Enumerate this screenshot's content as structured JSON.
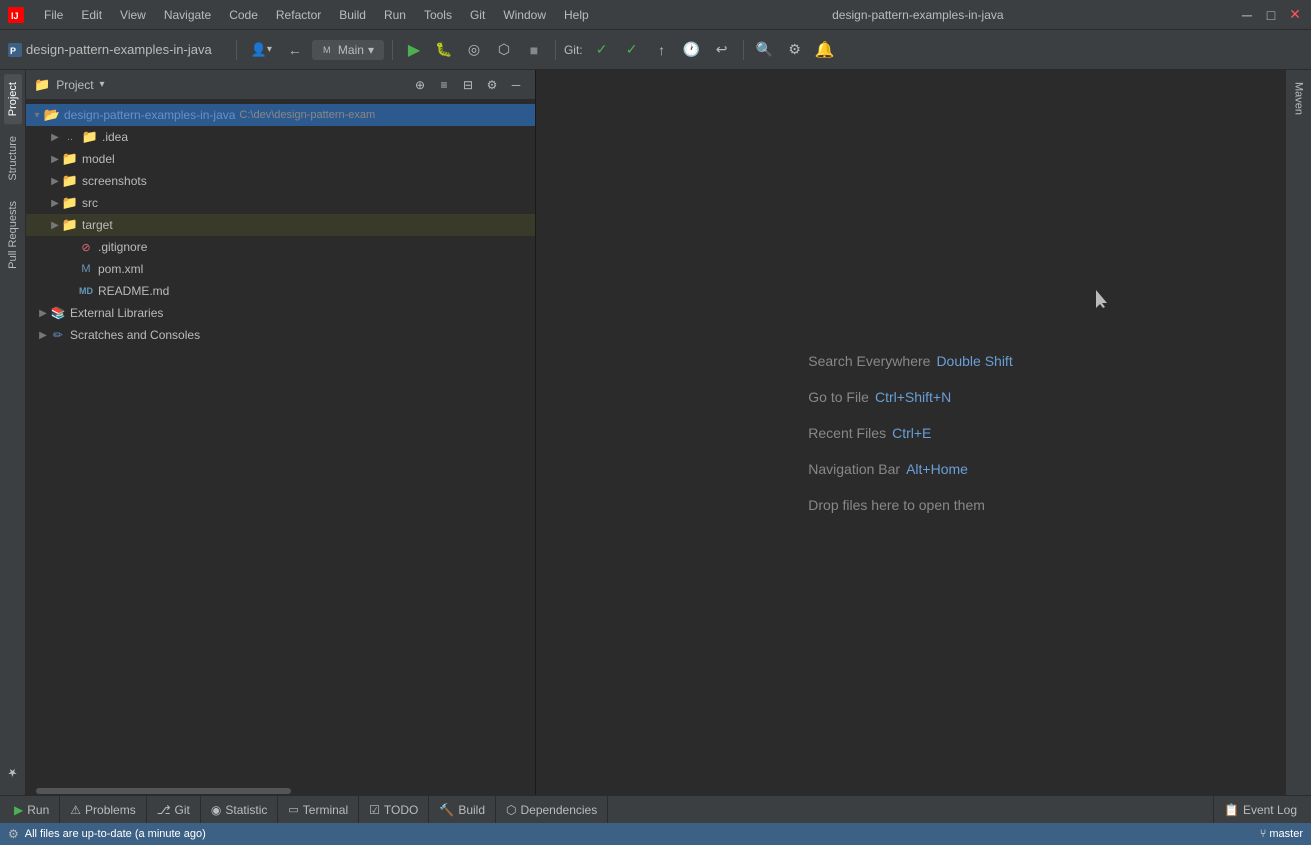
{
  "titlebar": {
    "logo": "IJ",
    "project": "design-pattern-examples-in-java",
    "menu": [
      "File",
      "Edit",
      "View",
      "Navigate",
      "Code",
      "Refactor",
      "Build",
      "Run",
      "Tools",
      "Git",
      "Window",
      "Help"
    ],
    "windowTitle": "design-pattern-examples-in-java",
    "minBtn": "─",
    "maxBtn": "□",
    "closeBtn": "✕"
  },
  "toolbar": {
    "projectName": "design-pattern-examples-in-java",
    "branchLabel": "Main",
    "gitLabel": "Git:",
    "icons": {
      "back": "←",
      "forward": "→",
      "globe": "🌐",
      "collapse": "≡",
      "settings": "⚙",
      "hide": "─",
      "run": "▶",
      "debug": "🐛",
      "coverage": "◎",
      "profile": "⬡",
      "stop": "■",
      "commit": "✓",
      "push": "↑",
      "update": "↓",
      "history": "🕐",
      "rollback": "↩",
      "search": "🔍",
      "settings2": "⚙"
    }
  },
  "sidebar": {
    "leftTabs": [
      "Project",
      "Structure",
      "Pull Requests",
      "Favorites"
    ]
  },
  "projectPanel": {
    "title": "Project",
    "dropdownArrow": "▾",
    "headerIcons": [
      "⊕",
      "≡",
      "⊟",
      "⚙",
      "─"
    ],
    "tree": [
      {
        "id": "root",
        "level": 0,
        "expanded": true,
        "selected": true,
        "icon": "folder-open",
        "label": "design-pattern-examples-in-java",
        "path": "C:\\dev\\design-pattern-exam",
        "type": "root"
      },
      {
        "id": "idea",
        "level": 1,
        "expanded": false,
        "icon": "folder",
        "label": ".idea",
        "type": "folder"
      },
      {
        "id": "model",
        "level": 1,
        "expanded": false,
        "icon": "folder",
        "label": "model",
        "type": "folder"
      },
      {
        "id": "screenshots",
        "level": 1,
        "expanded": false,
        "icon": "folder",
        "label": "screenshots",
        "type": "folder"
      },
      {
        "id": "src",
        "level": 1,
        "expanded": false,
        "icon": "folder",
        "label": "src",
        "type": "folder"
      },
      {
        "id": "target",
        "level": 1,
        "expanded": false,
        "selected": false,
        "highlighted": true,
        "icon": "folder-yellow",
        "label": "target",
        "type": "folder"
      },
      {
        "id": "gitignore",
        "level": 2,
        "icon": "git-file",
        "label": ".gitignore",
        "type": "file"
      },
      {
        "id": "pomxml",
        "level": 2,
        "icon": "xml-file",
        "label": "pom.xml",
        "type": "file"
      },
      {
        "id": "readme",
        "level": 2,
        "icon": "md-file",
        "label": "README.md",
        "type": "file"
      },
      {
        "id": "extlibs",
        "level": 1,
        "expanded": false,
        "icon": "ext-lib",
        "label": "External Libraries",
        "type": "special"
      },
      {
        "id": "scratches",
        "level": 1,
        "expanded": false,
        "icon": "scratch",
        "label": "Scratches and Consoles",
        "type": "special"
      }
    ]
  },
  "editor": {
    "hints": [
      {
        "text": "Search Everywhere",
        "shortcut": "Double Shift"
      },
      {
        "text": "Go to File",
        "shortcut": "Ctrl+Shift+N"
      },
      {
        "text": "Recent Files",
        "shortcut": "Ctrl+E"
      },
      {
        "text": "Navigation Bar",
        "shortcut": "Alt+Home"
      },
      {
        "text": "Drop files here to open them",
        "shortcut": ""
      }
    ]
  },
  "rightPanel": {
    "mavenLabel": "Maven"
  },
  "bottomTabs": [
    {
      "id": "run",
      "icon": "▶",
      "label": "Run"
    },
    {
      "id": "problems",
      "icon": "⚠",
      "label": "Problems"
    },
    {
      "id": "git",
      "icon": "⎇",
      "label": "Git"
    },
    {
      "id": "statistic",
      "icon": "◉",
      "label": "Statistic"
    },
    {
      "id": "terminal",
      "icon": ">_",
      "label": "Terminal"
    },
    {
      "id": "todo",
      "icon": "☑",
      "label": "TODO"
    },
    {
      "id": "build",
      "icon": "🔨",
      "label": "Build"
    },
    {
      "id": "dependencies",
      "icon": "⬡",
      "label": "Dependencies"
    }
  ],
  "statusBar": {
    "message": "All files are up-to-date (a minute ago)",
    "branch": "master",
    "branchIcon": "⑂",
    "eventLog": "Event Log"
  }
}
